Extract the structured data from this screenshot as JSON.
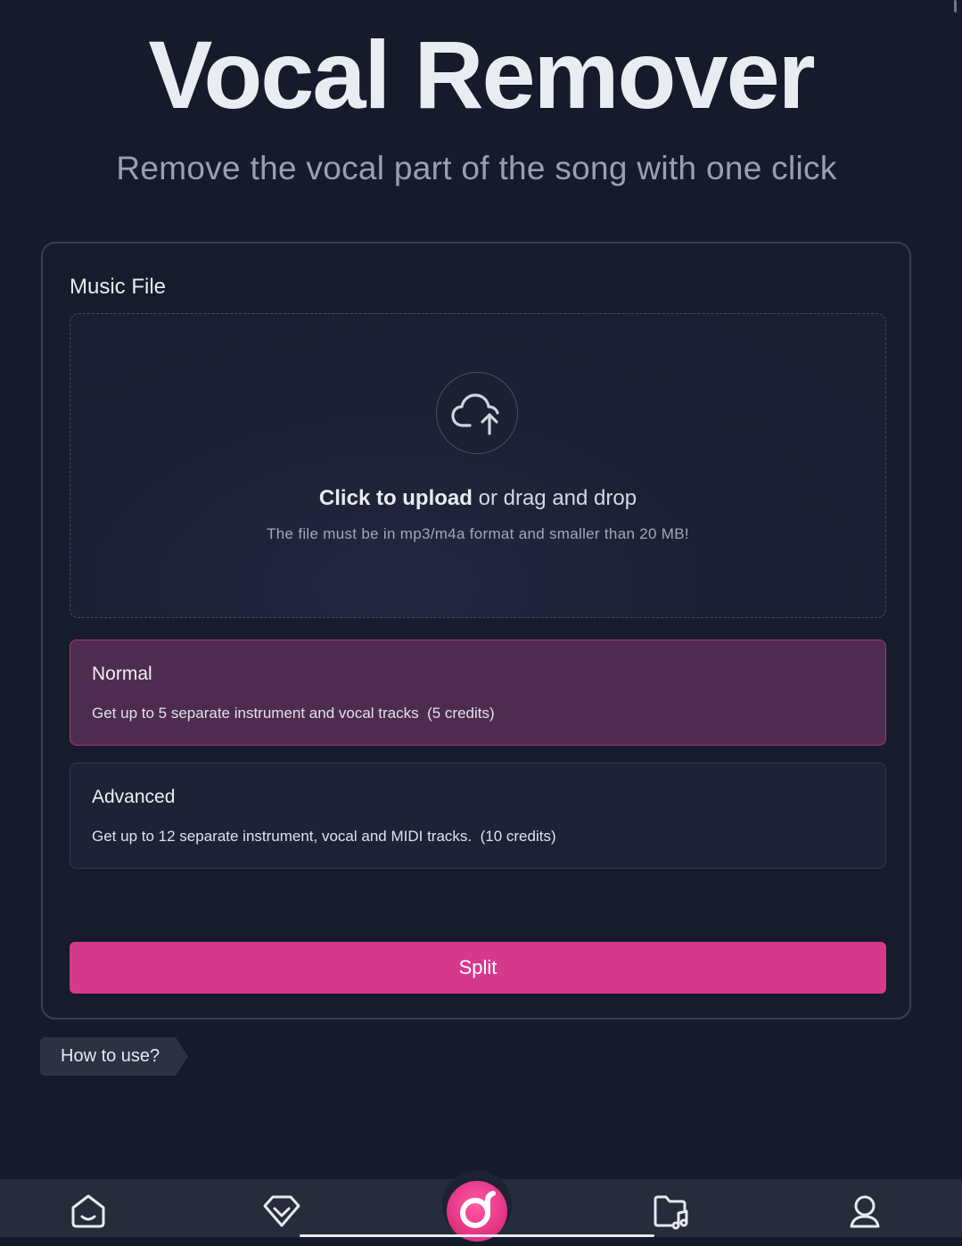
{
  "header": {
    "title": "Vocal Remover",
    "subtitle": "Remove the vocal part of the song with one click"
  },
  "form": {
    "label": "Music File",
    "upload": {
      "icon": "cloud-upload-icon",
      "action_text": "Click to upload",
      "rest_text": " or drag and drop",
      "hint": "The file must be in mp3/m4a format and smaller than 20 MB!"
    },
    "options": [
      {
        "name": "Normal",
        "description": "Get up to 5 separate instrument and vocal tracks  (5 credits)",
        "selected": true
      },
      {
        "name": "Advanced",
        "description": "Get up to 12 separate instrument, vocal and MIDI tracks.  (10 credits)",
        "selected": false
      }
    ],
    "submit_label": "Split"
  },
  "help": {
    "label": "How to use?"
  },
  "bottom_nav": {
    "items": [
      "home-icon",
      "diamond-icon",
      "app-logo-icon",
      "music-folder-icon",
      "profile-icon"
    ]
  },
  "colors": {
    "background": "#151b2b",
    "accent": "#d6388c",
    "selected_option_bg": "#4e2c4f",
    "selected_option_border": "#b0347a"
  }
}
